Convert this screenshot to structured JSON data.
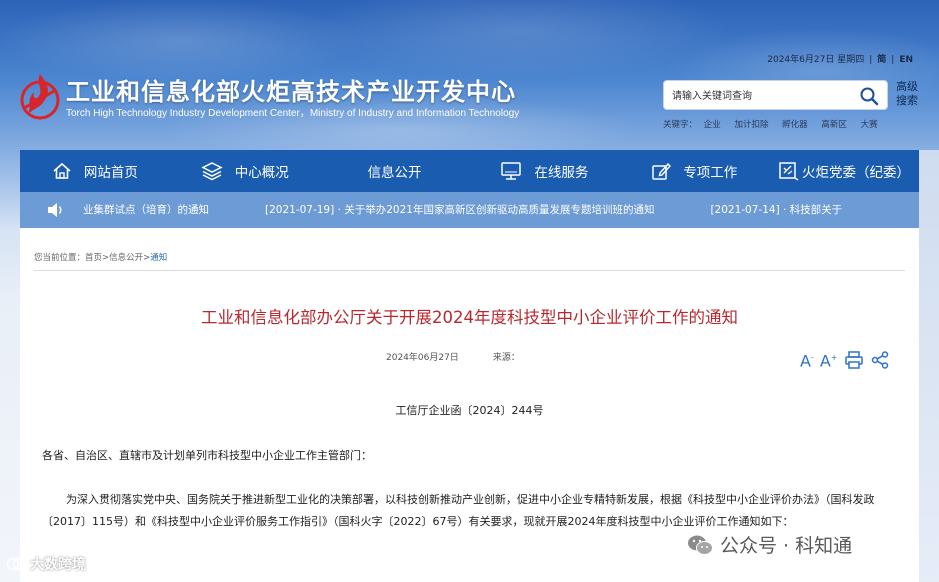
{
  "header": {
    "title_cn": "工业和信息化部火炬高技术产业开发中心",
    "title_en": "Torch High Technology Industry Development Center，Ministry of Industry and Information Technology",
    "date": "2024年6月27日 星期四",
    "lang_simplified": "简",
    "lang_en": "EN",
    "search_placeholder": "请输入关键词查询",
    "advanced_search": "高级搜索",
    "keywords_label": "关键字：",
    "keywords": [
      "企业",
      "加计扣除",
      "孵化器",
      "高新区",
      "大赛"
    ]
  },
  "nav": {
    "items": [
      {
        "label": "网站首页",
        "icon": "home-icon"
      },
      {
        "label": "中心概况",
        "icon": "layers-icon"
      },
      {
        "label": "信息公开",
        "icon": ""
      },
      {
        "label": "在线服务",
        "icon": "monitor-icon"
      },
      {
        "label": "专项工作",
        "icon": "edit-icon"
      },
      {
        "label": "火炬党委（纪委）",
        "icon": "party-icon"
      }
    ]
  },
  "ticker": {
    "items": [
      "业集群试点（培育）的通知",
      "[2021-07-19] · 关于举办2021年国家高新区创新驱动高质量发展专题培训班的通知",
      "[2021-07-14] · 科技部关于"
    ]
  },
  "breadcrumb": {
    "label": "您当前位置：",
    "home": "首页",
    "section": "信息公开",
    "current": "通知",
    "sep": ">"
  },
  "article": {
    "title": "工业和信息化部办公厅关于开展2024年度科技型中小企业评价工作的通知",
    "date": "2024年06月27日",
    "source_label": "来源：",
    "doc_no": "工信厅企业函〔2024〕244号",
    "salutation": "各省、自治区、直辖市及计划单列市科技型中小企业工作主管部门：",
    "body": "为深入贯彻落实党中央、国务院关于推进新型工业化的决策部署，以科技创新推动产业创新，促进中小企业专精特新发展，根据《科技型中小企业评价办法》（国科发政〔2017〕115号）和《科技型中小企业评价服务工作指引》（国科火字〔2022〕67号）有关要求，现就开展2024年度科技型中小企业评价工作通知如下："
  },
  "tools": {
    "font_decrease": "A",
    "font_increase": "A"
  },
  "watermarks": {
    "left": "大数跨境",
    "right": "公众号 · 科知通"
  },
  "colors": {
    "nav_bg": "#1a5db0",
    "ticker_bg": "#6d9bd6",
    "title_red": "#b8282e",
    "tool_blue": "#2f72c4"
  }
}
